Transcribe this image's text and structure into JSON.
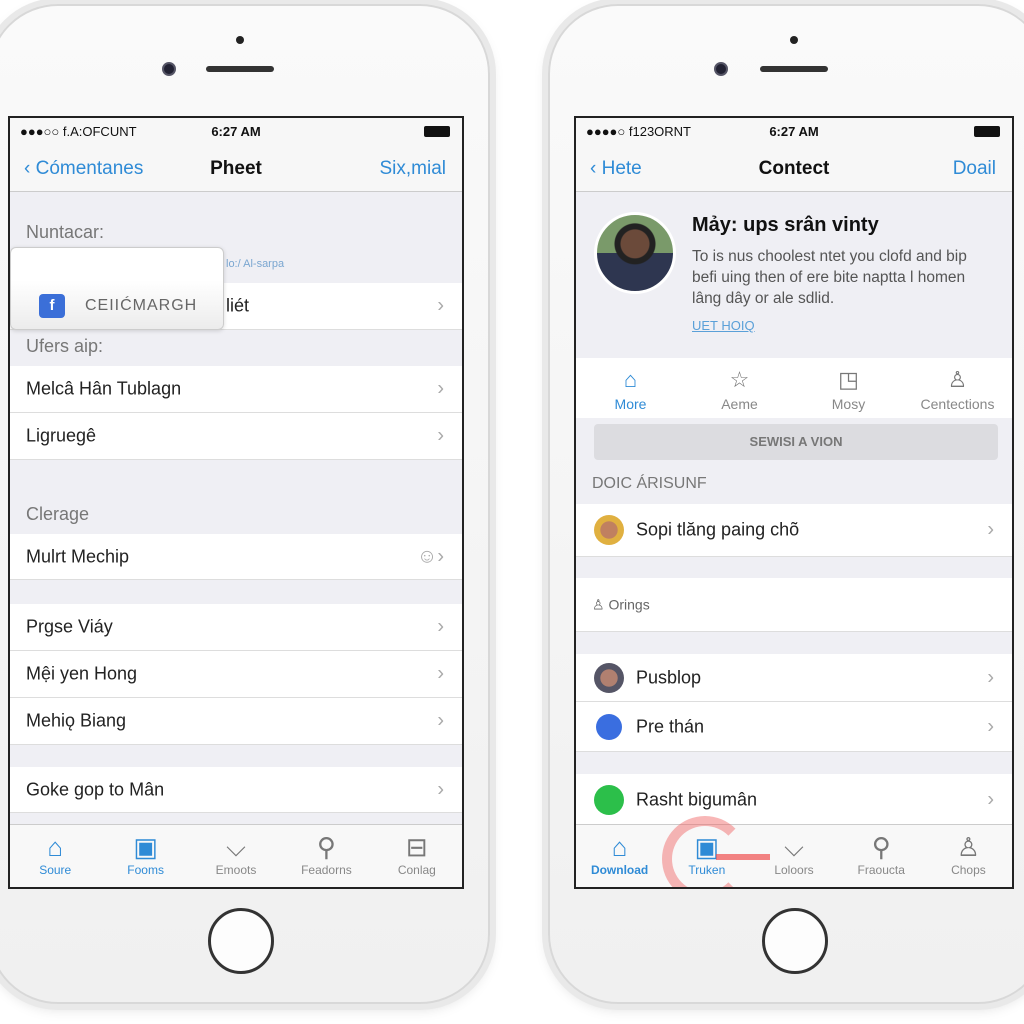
{
  "left_phone": {
    "status": {
      "carrier": "●●●○○ f.A:OFCUNT",
      "time": "6:27 AM"
    },
    "nav": {
      "back": "Cómentanes",
      "title": "Pheet",
      "right": "Six,mial"
    },
    "section1": "Nuntacar:",
    "popup": {
      "sub": "lo:/ Al-sarpa",
      "label": "CEIIĆMARGH"
    },
    "row_hidden": "liét",
    "section2": "Ufers aip:",
    "rows2": [
      "Melcâ Hân Tublagn",
      "Ligruegê"
    ],
    "section3": "Clerage",
    "row3": "Mulrt Mechip",
    "rows4": [
      "Prgse Viáy",
      "Mệi yen Hong",
      "Mehiǫ Biang"
    ],
    "row5": "Goke gop to Mân",
    "tabs": [
      {
        "label": "Soure",
        "icon": "home-icon"
      },
      {
        "label": "Fooms",
        "icon": "bag-icon"
      },
      {
        "label": "Emoots",
        "icon": "chevron-box-icon"
      },
      {
        "label": "Feadorns",
        "icon": "microphone-icon"
      },
      {
        "label": "Conlag",
        "icon": "tray-icon"
      }
    ]
  },
  "right_phone": {
    "status": {
      "carrier": "●●●●○ f123ORNT",
      "time": "6:27 AM"
    },
    "nav": {
      "back": "Hete",
      "title": "Contect",
      "right": "Doail"
    },
    "profile": {
      "name": "Mảy: ups srân vinty",
      "bio": "To is nus choolest ntet you clofd and bip befi uing then of ere bite naptta l homen lâng dây or ale sdlid.",
      "link": "UET HOIQ"
    },
    "segments": [
      {
        "label": "More",
        "icon": "home-icon"
      },
      {
        "label": "Aeme",
        "icon": "star-icon"
      },
      {
        "label": "Mosy",
        "icon": "square-icon"
      },
      {
        "label": "Centections",
        "icon": "person-icon"
      }
    ],
    "button": "SEWISI A VION",
    "section": "DOIC ÁRISUNF",
    "row1": "Sopi tlăng paing chõ",
    "row2": "Orings",
    "rows3": [
      "Pusblop",
      "Pre thán"
    ],
    "row4": "Rasht bigumân",
    "tabs": [
      {
        "label": "Download",
        "icon": "home-icon"
      },
      {
        "label": "Truken",
        "icon": "bag-icon"
      },
      {
        "label": "Loloors",
        "icon": "chevron-box-icon"
      },
      {
        "label": "Fraoucta",
        "icon": "microphone-icon"
      },
      {
        "label": "Chops",
        "icon": "person-icon"
      }
    ]
  },
  "colors": {
    "accent": "#2f8bd6",
    "highlight": "#f06060"
  }
}
